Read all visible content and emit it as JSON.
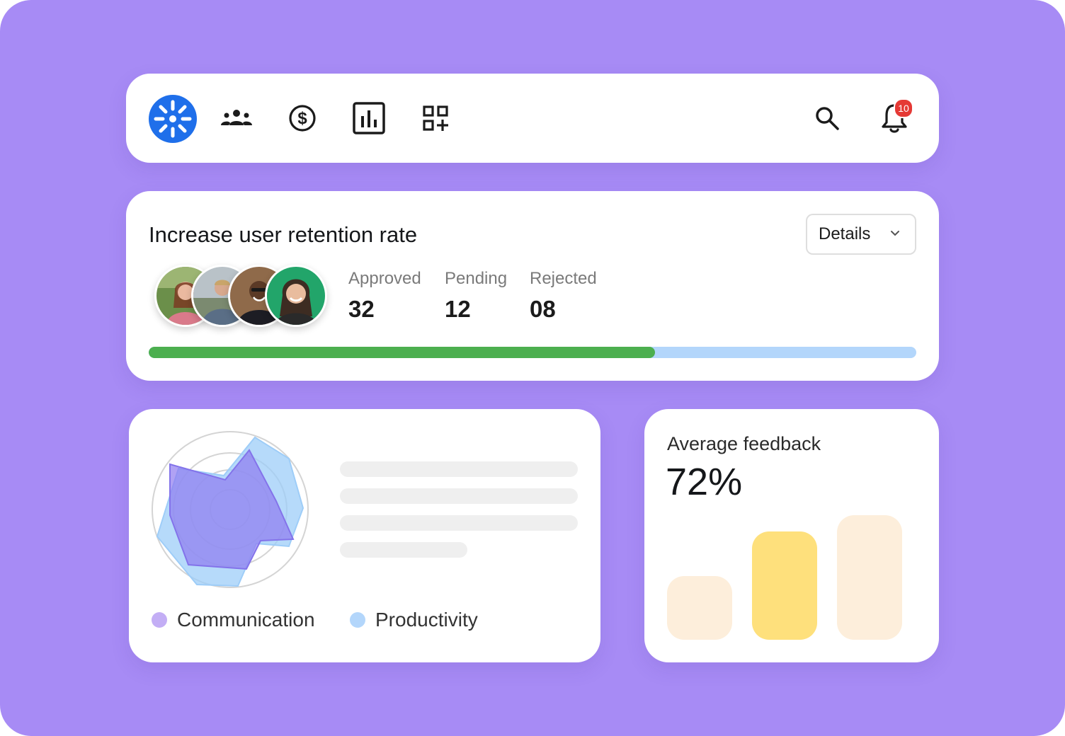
{
  "nav": {
    "icons": [
      "logo-icon",
      "team-icon",
      "dollar-icon",
      "chart-icon",
      "apps-icon",
      "search-icon",
      "bell-icon"
    ],
    "notifications_count": "10"
  },
  "retention": {
    "title": "Increase user retention rate",
    "details_label": "Details",
    "stats": [
      {
        "label": "Approved",
        "value": "32"
      },
      {
        "label": "Pending",
        "value": "12"
      },
      {
        "label": "Rejected",
        "value": "08"
      }
    ],
    "progress_fraction": 0.66
  },
  "radar": {
    "legend": [
      {
        "label": "Communication",
        "color": "#c3aef5"
      },
      {
        "label": "Productivity",
        "color": "#b3d6fb"
      }
    ]
  },
  "feedback": {
    "title": "Average feedback",
    "value": "72%",
    "bars": [
      {
        "level": 0.5,
        "color": "#fdeedb"
      },
      {
        "level": 0.85,
        "color": "#fee07c"
      },
      {
        "level": 0.98,
        "color": "#fdeedb"
      }
    ]
  },
  "colors": {
    "background": "#a78bf5",
    "brand": "#1f6fea",
    "progress_fill": "#4caf4f",
    "progress_track": "#b3d6fb",
    "badge": "#e53935"
  }
}
